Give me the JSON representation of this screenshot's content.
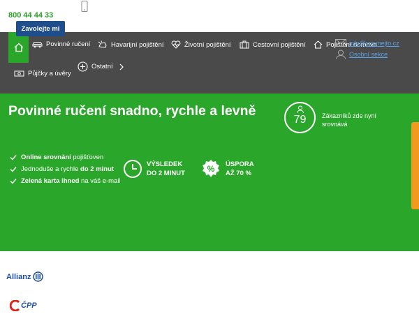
{
  "top": {
    "phone": "800 44 44 33",
    "callme_label": "Zavolejte mi"
  },
  "nav": {
    "items": [
      {
        "label": "Povinné ručení",
        "icon": "car-icon"
      },
      {
        "label": "Havarijní pojištění",
        "icon": "crash-car-icon"
      },
      {
        "label": "Životní pojištění",
        "icon": "heart-pulse-icon"
      },
      {
        "label": "Cestovní pojištění",
        "icon": "suitcase-icon"
      },
      {
        "label": "Pojištění domova",
        "icon": "house-icon"
      },
      {
        "label": "Půjčky a úvěry",
        "icon": "money-icon"
      },
      {
        "label": "Ostatní",
        "icon": "plus-circle-icon"
      }
    ],
    "email_link": "info@srovnejto.cz",
    "user_link": "Osobní sekce"
  },
  "hero": {
    "title": "Povinné ručení snadno, rychle a levně",
    "bullets": [
      {
        "bold": "Online srovnání",
        "rest": " pojišťoven",
        "bold_first": true
      },
      {
        "pre": "Jednoduše a rychle ",
        "bold": "do 2 minut"
      },
      {
        "bold": "Zelená karta ihned",
        "rest": " na váš e-mail",
        "bold_first": true
      }
    ],
    "result_line1": "VÝSLEDEK",
    "result_line2": "DO 2 MINUT",
    "saving_line1": "ÚSPORA",
    "saving_line2": "AŽ 70 %",
    "customers_count": "79",
    "customers_text": "Zákazníků zde nyní srovnává"
  },
  "partners": {
    "allianz": "Allianz",
    "cpp": "ČPP"
  },
  "colors": {
    "green": "#2aa72a",
    "nav_bg": "#4a4a4a",
    "blue": "#1f4e8c",
    "orange": "#f39a1e"
  }
}
